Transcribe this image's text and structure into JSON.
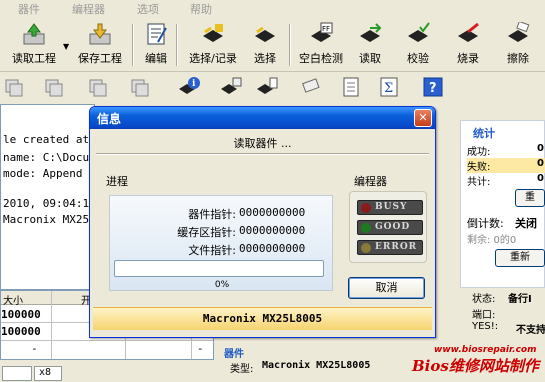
{
  "menu": [
    "器件",
    "编程器",
    "选项",
    "帮助"
  ],
  "toolbar": [
    {
      "label": "读取工程",
      "icon": "open-project-icon"
    },
    {
      "label": "保存工程",
      "icon": "save-project-icon"
    },
    {
      "label": "编辑",
      "icon": "edit-icon"
    },
    {
      "label": "选择/记录",
      "icon": "select-record-chip-icon"
    },
    {
      "label": "选择",
      "icon": "select-chip-icon"
    },
    {
      "label": "空白检测",
      "icon": "blank-check-icon"
    },
    {
      "label": "读取",
      "icon": "read-chip-icon"
    },
    {
      "label": "校验",
      "icon": "verify-chip-icon"
    },
    {
      "label": "烧录",
      "icon": "program-chip-icon"
    },
    {
      "label": "擦除",
      "icon": "erase-chip-icon"
    }
  ],
  "log": [
    "le created at 1",
    "name: C:\\Docume",
    "mode: Append",
    "",
    "2010, 09:04:17",
    " Macronix MX25L"
  ],
  "table": {
    "headers": [
      "大小",
      "开"
    ],
    "rows": [
      [
        "100000",
        ""
      ],
      [
        "100000",
        ""
      ],
      [
        "-",
        "-"
      ]
    ]
  },
  "bottom_tab": "x8",
  "stats": {
    "title": "统计",
    "success_label": "成功:",
    "success_value": "0",
    "fail_label": "失败:",
    "fail_value": "0",
    "total_label": "共计:",
    "total_value": "0",
    "reset_label": "重",
    "countdown_label": "倒计数:",
    "countdown_value": "关闭",
    "remaining": "剩余: 0的0",
    "reset2_label": "重新"
  },
  "rightinfo": {
    "status_label": "状态:",
    "status_value": "备行I",
    "port_label": "端口:",
    "yes_label": "YES!:",
    "yes_value": "不支持"
  },
  "device_panel": {
    "title": "器件",
    "type_label": "类型:",
    "type_value": "Macronix  MX25L8005"
  },
  "watermark": {
    "url": "www.biosrepair.com",
    "text": "Bios维修网站制作"
  },
  "dialog": {
    "title": "信息",
    "message": "读取器件 ...",
    "progress_label": "进程",
    "programmer_label": "编程器",
    "pointers": [
      {
        "label": "器件指针:",
        "value": "0000000000"
      },
      {
        "label": "缓存区指针:",
        "value": "0000000000"
      },
      {
        "label": "文件指针:",
        "value": "0000000000"
      }
    ],
    "progress": 0,
    "progress_text": "0%",
    "leds": [
      {
        "label": "BUSY",
        "color": "#8b1a1a"
      },
      {
        "label": "GOOD",
        "color": "#1f7a1f"
      },
      {
        "label": "ERROR",
        "color": "#8a7a3a"
      }
    ],
    "cancel_label": "取消",
    "device": "Macronix  MX25L8005"
  }
}
